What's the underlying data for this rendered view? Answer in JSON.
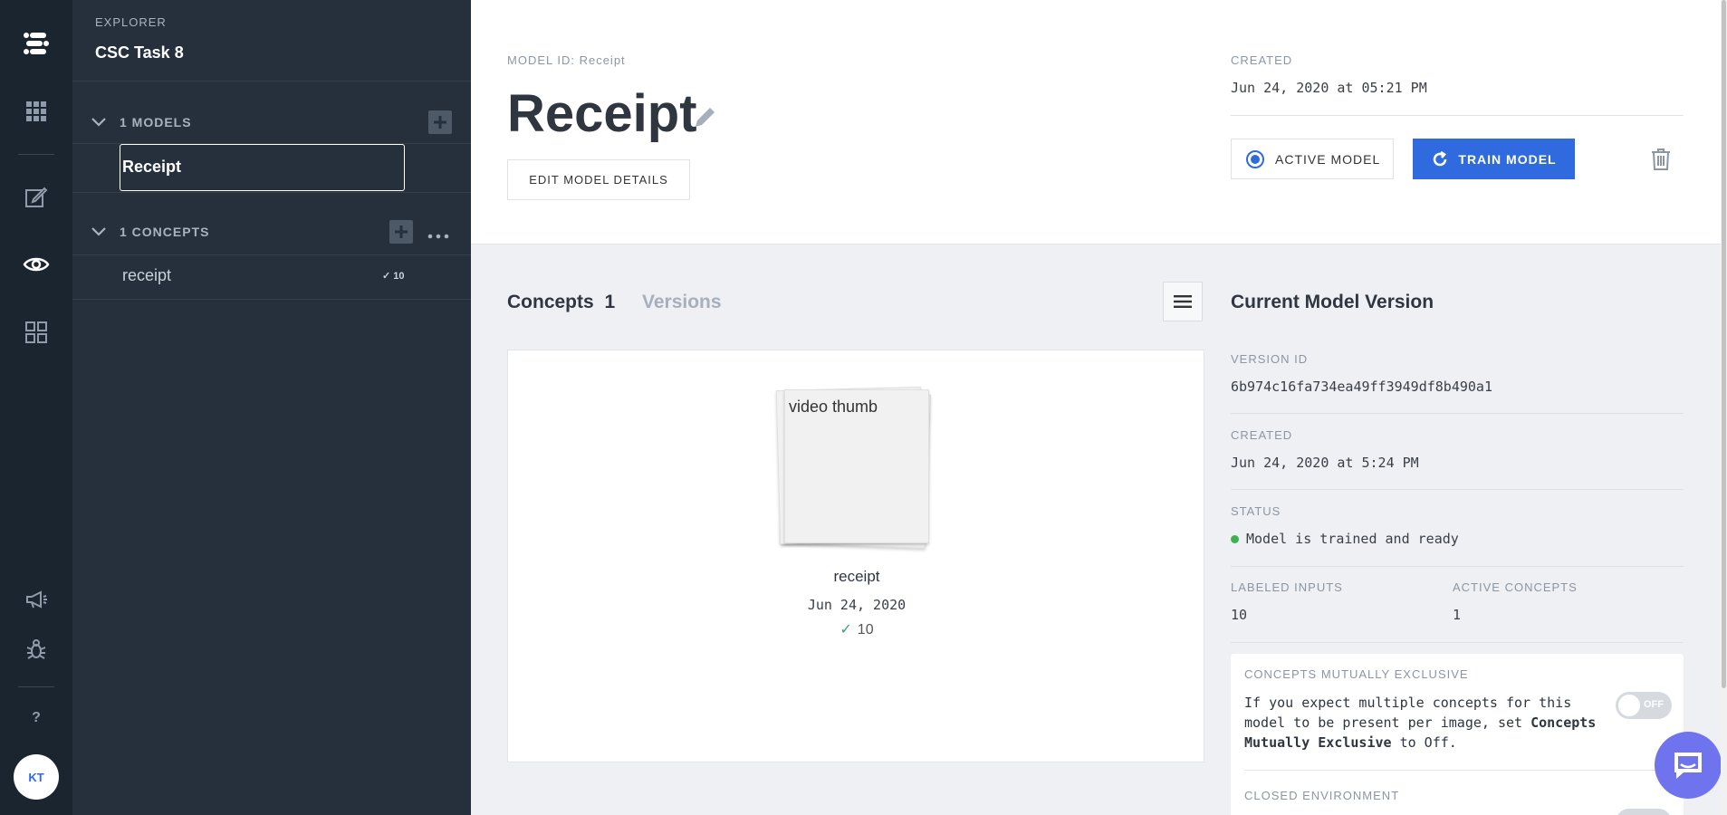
{
  "rail": {
    "avatar_initials": "KT",
    "help": "?"
  },
  "explorer": {
    "label": "EXPLORER",
    "app_title": "CSC Task 8",
    "models_header": "1 MODELS",
    "model_items": [
      "Receipt"
    ],
    "concepts_header": "1 CONCEPTS",
    "concept_items": [
      {
        "name": "receipt",
        "count": "10"
      }
    ]
  },
  "header": {
    "model_id_label": "MODEL ID: Receipt",
    "title": "Receipt",
    "edit_button": "EDIT MODEL DETAILS",
    "created_label": "CREATED",
    "created_value": "Jun 24, 2020 at 05:21 PM",
    "active_button": "ACTIVE MODEL",
    "train_button": "TRAIN MODEL"
  },
  "tabs": {
    "concepts_label": "Concepts",
    "concepts_count": "1",
    "versions_label": "Versions"
  },
  "concept_card": {
    "thumb_alt": "video thumb",
    "name": "receipt",
    "date": "Jun 24, 2020",
    "count": "10"
  },
  "version": {
    "title": "Current Model Version",
    "version_id_label": "VERSION ID",
    "version_id": "6b974c16fa734ea49ff3949df8b490a1",
    "created_label": "CREATED",
    "created_value": "Jun 24, 2020 at 5:24 PM",
    "status_label": "STATUS",
    "status_value": "Model is trained and ready",
    "labeled_inputs_label": "LABELED INPUTS",
    "labeled_inputs_value": "10",
    "active_concepts_label": "ACTIVE CONCEPTS",
    "active_concepts_value": "1",
    "mutually_exclusive_label": "CONCEPTS MUTUALLY EXCLUSIVE",
    "me_text_1": "If you expect multiple concepts for this model to be present per image, set ",
    "me_text_bold": "Concepts Mutually Exclusive",
    "me_text_2": " to Off.",
    "toggle_label": "OFF",
    "closed_env_label": "CLOSED ENVIRONMENT"
  },
  "colors": {
    "accent": "#2f6bde",
    "rail_bg": "#1b2530",
    "explorer_bg": "#25303c",
    "status_ok": "#3db14f",
    "chat": "#6f74ee"
  }
}
